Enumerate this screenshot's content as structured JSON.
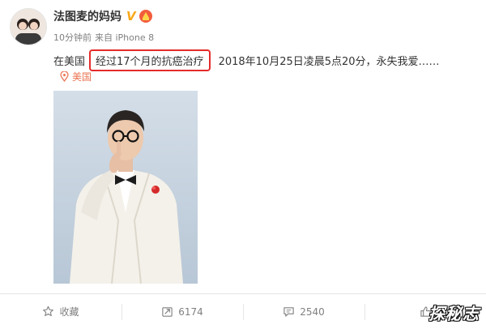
{
  "post": {
    "author_name": "法图麦的妈妈",
    "vip_badge": "V",
    "meta": {
      "time": "10分钟前",
      "source": "来自 iPhone 8"
    },
    "text_prefix": "在美国",
    "text_highlight": "经过17个月的抗癌治疗",
    "text_suffix": "2018年10月25日凌晨5点20分，永失我爱……",
    "location": "美国"
  },
  "actions": {
    "favorite_label": "收藏",
    "repost_count": "6174",
    "comment_count": "2540"
  },
  "watermark": "探秘志",
  "colors": {
    "highlight_border": "#e52b2b",
    "location": "#eb7350",
    "vip": "#f7a81a",
    "photo_background": "#c9d6e3",
    "suit": "#f4f1ea"
  }
}
